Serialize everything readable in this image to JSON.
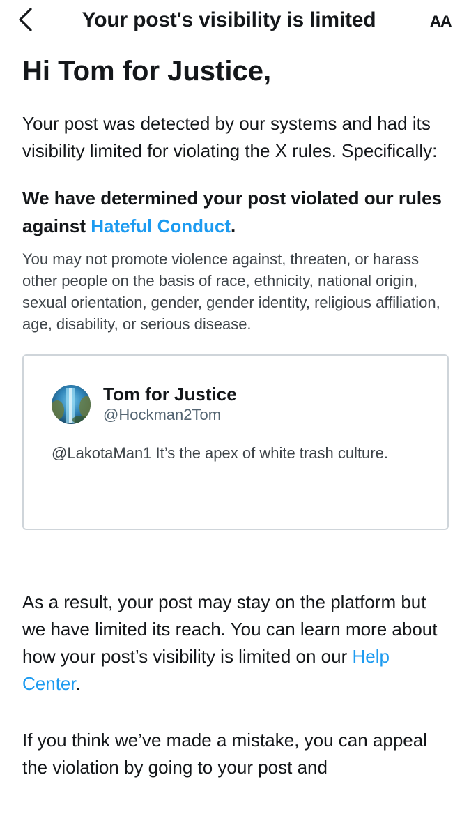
{
  "nav": {
    "title": "Your post's visibility is limited",
    "text_size_label": "AA"
  },
  "greeting": "Hi Tom for Justice,",
  "intro": "Your post was detected by our systems and had its visibility limited for violating the X rules. Specifically:",
  "violation": {
    "text_before": "We have determined your post violated our rules against ",
    "rule_link": "Hateful Conduct",
    "text_after": "."
  },
  "rule_description": "You may not promote violence against, threaten, or harass other people on the basis of race, ethnicity, national origin, sexual orientation, gender, gender identity, religious affiliation, age, disability, or serious disease.",
  "post": {
    "author_name": "Tom for Justice",
    "author_handle": "@Hockman2Tom",
    "text": "@LakotaMan1 It’s the apex of white trash culture."
  },
  "result": {
    "text_before": "As a result, your post may stay on the platform but we have limited its reach. You can learn more about how your post’s visibility is limited on our ",
    "help_link": "Help Center",
    "text_after": "."
  },
  "appeal": {
    "text": "If you think we’ve made a mistake, you can appeal the violation by going to your post and"
  },
  "colors": {
    "link": "#1d9bf0",
    "text": "#14171a",
    "secondary_text": "#536471",
    "card_border": "#cfd5da"
  },
  "icons": {
    "back": "chevron-left-icon",
    "text_size": "text-size-icon"
  }
}
